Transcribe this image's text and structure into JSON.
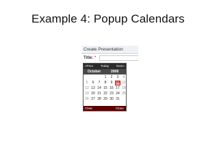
{
  "slide": {
    "title": "Example 4: Popup Calendars"
  },
  "app": {
    "header": "Create Presentation",
    "title_label": "Title:",
    "required_mark": "*"
  },
  "calendar": {
    "prev": "«Prev",
    "today": "Today",
    "next": "Next»",
    "month": "October",
    "year": "2008",
    "today_date": "10",
    "weeks": [
      [
        "",
        "",
        "",
        "1",
        "2",
        "3",
        "4"
      ],
      [
        "5",
        "6",
        "7",
        "8",
        "9",
        "10",
        "11"
      ],
      [
        "12",
        "13",
        "14",
        "15",
        "16",
        "17",
        "18"
      ],
      [
        "19",
        "20",
        "21",
        "22",
        "23",
        "24",
        "25"
      ],
      [
        "26",
        "27",
        "28",
        "29",
        "30",
        "31",
        ""
      ]
    ],
    "clear": "Clear",
    "close": "Close"
  }
}
